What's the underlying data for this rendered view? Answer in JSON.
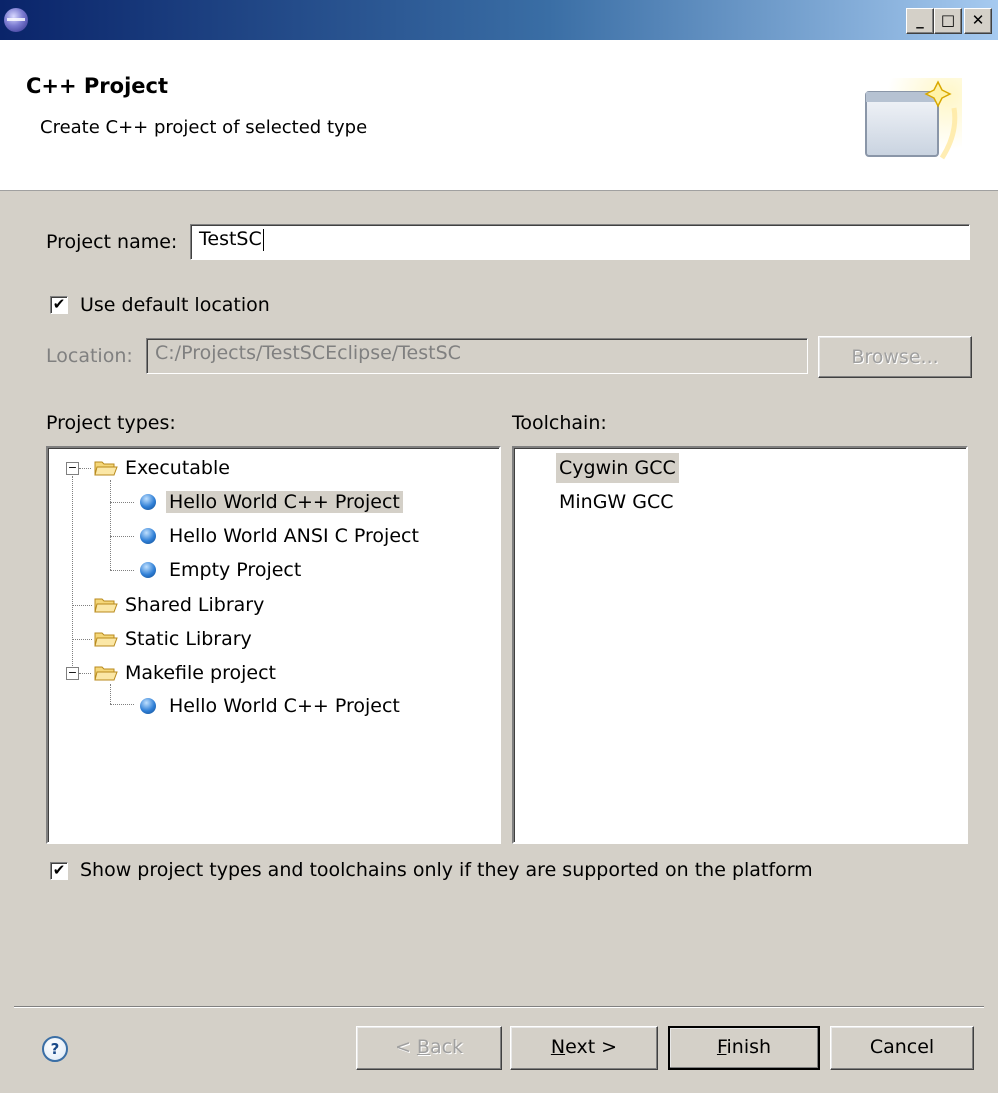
{
  "window": {
    "minimize_glyph": "_",
    "maximize_glyph": "□",
    "close_glyph": "✕"
  },
  "header": {
    "title": "C++ Project",
    "subtitle": "Create C++ project of selected type"
  },
  "form": {
    "project_name_label": "Project name:",
    "project_name_value": "TestSC",
    "use_default_location_label": "Use default location",
    "use_default_location_checked": true,
    "location_label": "Location:",
    "location_value": "C:/Projects/TestSCEclipse/TestSC",
    "browse_label": "Browse...",
    "check_mark": "✔"
  },
  "project_types": {
    "label": "Project types:",
    "items": [
      {
        "label": "Executable",
        "kind": "folder",
        "expanded": true
      },
      {
        "label": "Hello World C++ Project",
        "kind": "template",
        "selected": true
      },
      {
        "label": "Hello World ANSI C Project",
        "kind": "template"
      },
      {
        "label": "Empty Project",
        "kind": "template"
      },
      {
        "label": "Shared Library",
        "kind": "folder"
      },
      {
        "label": "Static Library",
        "kind": "folder"
      },
      {
        "label": "Makefile project",
        "kind": "folder",
        "expanded": true
      },
      {
        "label": "Hello World C++ Project",
        "kind": "template"
      }
    ],
    "collapse_glyph": "−"
  },
  "toolchain": {
    "label": "Toolchain:",
    "items": [
      {
        "label": "Cygwin GCC",
        "selected": true
      },
      {
        "label": "MinGW GCC"
      }
    ]
  },
  "filter": {
    "label": "Show project types and toolchains only if they are supported on the platform",
    "checked": true
  },
  "footer": {
    "help_glyph": "?",
    "back": {
      "prefix": "< ",
      "mnemonic": "B",
      "rest": "ack"
    },
    "next": {
      "mnemonic": "N",
      "rest": "ext >"
    },
    "finish": {
      "mnemonic": "F",
      "rest": "inish"
    },
    "cancel": "Cancel"
  },
  "colors": {
    "title_gradient_start": "#0a246a",
    "title_gradient_end": "#a6caf0",
    "dialog_bg": "#d4d0c8",
    "template_ball": "#2f7fd6",
    "folder": "#f5c84c"
  }
}
